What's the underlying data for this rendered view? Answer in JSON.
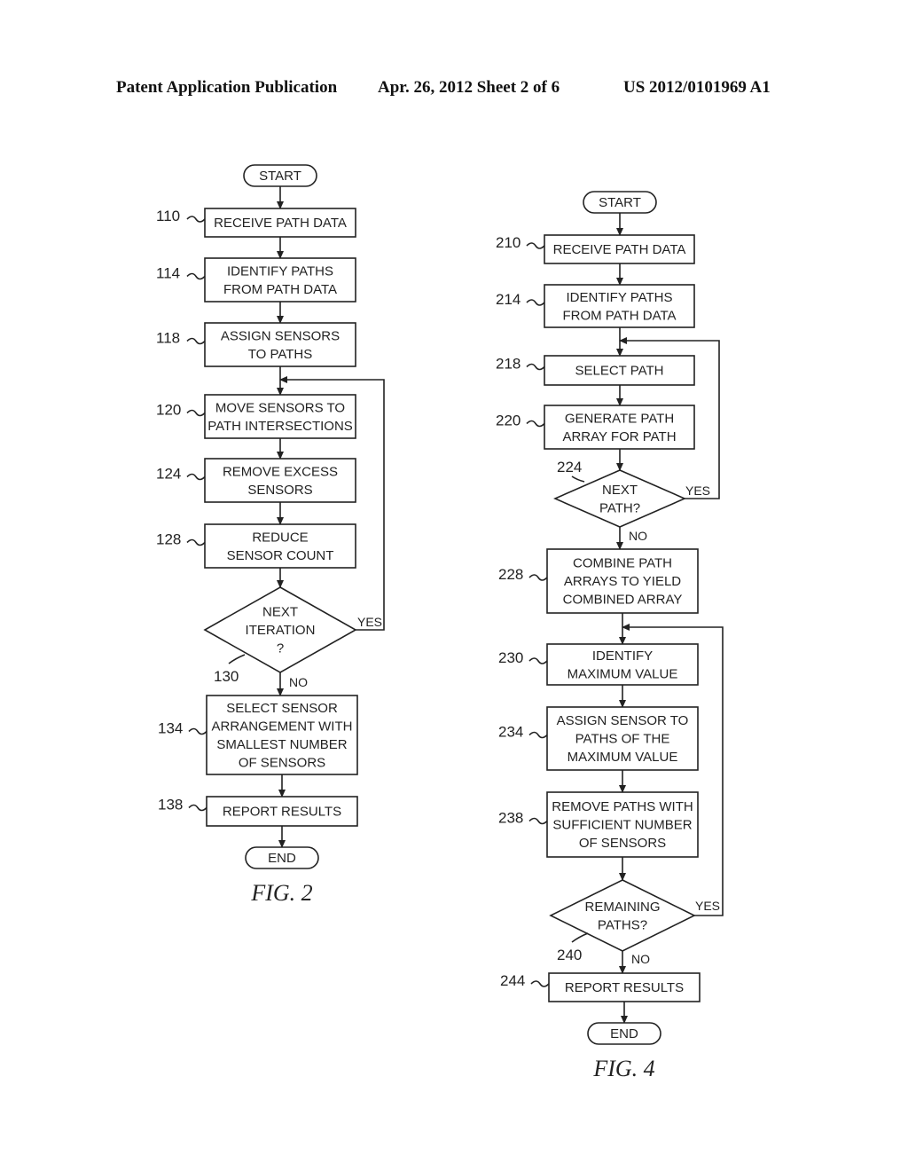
{
  "header": {
    "publication": "Patent Application Publication",
    "date_sheet": "Apr. 26, 2012  Sheet 2 of 6",
    "number": "US 2012/0101969 A1"
  },
  "fig2": {
    "caption": "FIG. 2",
    "start": "START",
    "end": "END",
    "steps": [
      {
        "ref": "110",
        "lines": [
          "RECEIVE PATH DATA"
        ]
      },
      {
        "ref": "114",
        "lines": [
          "IDENTIFY PATHS",
          "FROM PATH DATA"
        ]
      },
      {
        "ref": "118",
        "lines": [
          "ASSIGN SENSORS",
          "TO PATHS"
        ]
      },
      {
        "ref": "120",
        "lines": [
          "MOVE SENSORS TO",
          "PATH INTERSECTIONS"
        ]
      },
      {
        "ref": "124",
        "lines": [
          "REMOVE EXCESS",
          "SENSORS"
        ]
      },
      {
        "ref": "128",
        "lines": [
          "REDUCE",
          "SENSOR COUNT"
        ]
      }
    ],
    "decision": {
      "ref": "130",
      "lines": [
        "NEXT",
        "ITERATION",
        "?"
      ],
      "yes": "YES",
      "no": "NO"
    },
    "after": [
      {
        "ref": "134",
        "lines": [
          "SELECT SENSOR",
          "ARRANGEMENT WITH",
          "SMALLEST NUMBER",
          "OF SENSORS"
        ]
      },
      {
        "ref": "138",
        "lines": [
          "REPORT RESULTS"
        ]
      }
    ]
  },
  "fig4": {
    "caption": "FIG. 4",
    "start": "START",
    "end": "END",
    "steps": [
      {
        "ref": "210",
        "lines": [
          "RECEIVE PATH DATA"
        ]
      },
      {
        "ref": "214",
        "lines": [
          "IDENTIFY PATHS",
          "FROM PATH DATA"
        ]
      },
      {
        "ref": "218",
        "lines": [
          "SELECT PATH"
        ]
      },
      {
        "ref": "220",
        "lines": [
          "GENERATE PATH",
          "ARRAY FOR PATH"
        ]
      }
    ],
    "decision1": {
      "ref": "224",
      "lines": [
        "NEXT",
        "PATH?"
      ],
      "yes": "YES",
      "no": "NO"
    },
    "mid": [
      {
        "ref": "228",
        "lines": [
          "COMBINE PATH",
          "ARRAYS TO YIELD",
          "COMBINED ARRAY"
        ]
      },
      {
        "ref": "230",
        "lines": [
          "IDENTIFY",
          "MAXIMUM VALUE"
        ]
      },
      {
        "ref": "234",
        "lines": [
          "ASSIGN SENSOR TO",
          "PATHS OF THE",
          "MAXIMUM VALUE"
        ]
      },
      {
        "ref": "238",
        "lines": [
          "REMOVE PATHS WITH",
          "SUFFICIENT NUMBER",
          "OF SENSORS"
        ]
      }
    ],
    "decision2": {
      "ref": "240",
      "lines": [
        "REMAINING",
        "PATHS?"
      ],
      "yes": "YES",
      "no": "NO"
    },
    "after": [
      {
        "ref": "244",
        "lines": [
          "REPORT RESULTS"
        ]
      }
    ]
  }
}
